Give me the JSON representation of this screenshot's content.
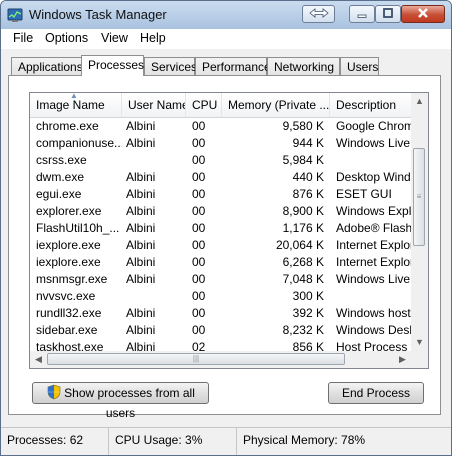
{
  "window": {
    "title": "Windows Task Manager",
    "icon": "task-manager-icon"
  },
  "menu": [
    "File",
    "Options",
    "View",
    "Help"
  ],
  "tabs": [
    {
      "label": "Applications"
    },
    {
      "label": "Processes"
    },
    {
      "label": "Services"
    },
    {
      "label": "Performance"
    },
    {
      "label": "Networking"
    },
    {
      "label": "Users"
    }
  ],
  "active_tab": "Processes",
  "table": {
    "columns": [
      "Image Name",
      "User Name",
      "CPU",
      "Memory (Private ...",
      "Description"
    ],
    "rows": [
      {
        "name": "chrome.exe",
        "user": "Albini",
        "cpu": "00",
        "mem": "9,580 K",
        "desc": "Google Chrome"
      },
      {
        "name": "companionuse...",
        "user": "Albini",
        "cpu": "00",
        "mem": "944 K",
        "desc": "Windows Live M"
      },
      {
        "name": "csrss.exe",
        "user": "",
        "cpu": "00",
        "mem": "5,984 K",
        "desc": ""
      },
      {
        "name": "dwm.exe",
        "user": "Albini",
        "cpu": "00",
        "mem": "440 K",
        "desc": "Desktop Windo"
      },
      {
        "name": "egui.exe",
        "user": "Albini",
        "cpu": "00",
        "mem": "876 K",
        "desc": "ESET GUI"
      },
      {
        "name": "explorer.exe",
        "user": "Albini",
        "cpu": "00",
        "mem": "8,900 K",
        "desc": "Windows Explo"
      },
      {
        "name": "FlashUtil10h_...",
        "user": "Albini",
        "cpu": "00",
        "mem": "1,176 K",
        "desc": "Adobe® Flash®"
      },
      {
        "name": "iexplore.exe",
        "user": "Albini",
        "cpu": "00",
        "mem": "20,064 K",
        "desc": "Internet Explor"
      },
      {
        "name": "iexplore.exe",
        "user": "Albini",
        "cpu": "00",
        "mem": "6,268 K",
        "desc": "Internet Explor"
      },
      {
        "name": "msnmsgr.exe",
        "user": "Albini",
        "cpu": "00",
        "mem": "7,048 K",
        "desc": "Windows Live M"
      },
      {
        "name": "nvvsvc.exe",
        "user": "",
        "cpu": "00",
        "mem": "300 K",
        "desc": ""
      },
      {
        "name": "rundll32.exe",
        "user": "Albini",
        "cpu": "00",
        "mem": "392 K",
        "desc": "Windows host p"
      },
      {
        "name": "sidebar.exe",
        "user": "Albini",
        "cpu": "00",
        "mem": "8,232 K",
        "desc": "Windows Deskt"
      },
      {
        "name": "taskhost.exe",
        "user": "Albini",
        "cpu": "02",
        "mem": "856 K",
        "desc": "Host Process fo"
      }
    ]
  },
  "buttons": {
    "show_all": "Show processes from all users",
    "end_process": "End Process"
  },
  "status": {
    "processes": "Processes: 62",
    "cpu": "CPU Usage: 3%",
    "memory": "Physical Memory: 78%"
  }
}
